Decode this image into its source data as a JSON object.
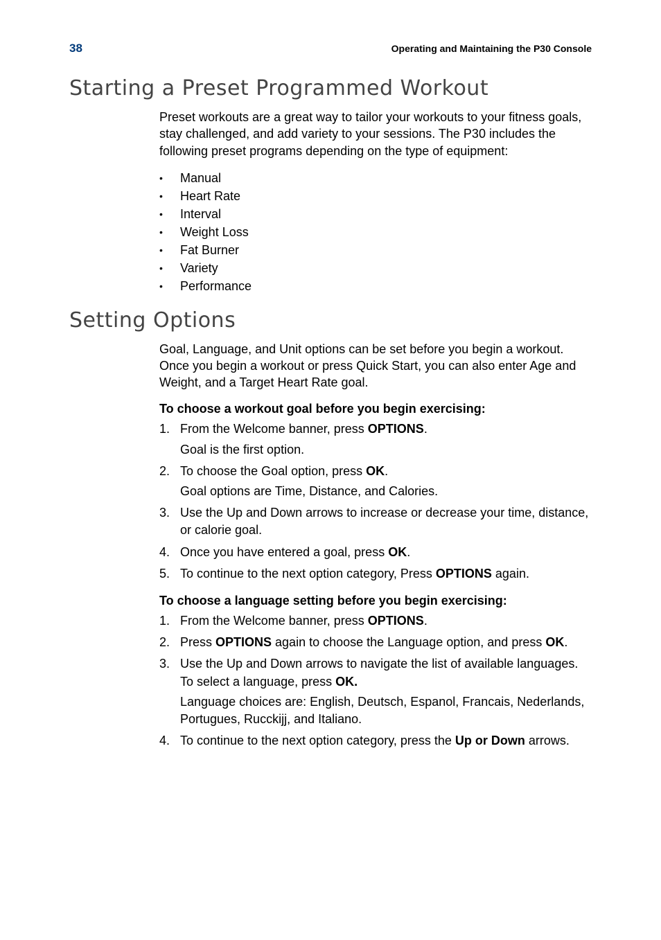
{
  "header": {
    "page_number": "38",
    "running_title": "Operating and Maintaining the P30 Console"
  },
  "section1": {
    "title": "Starting a Preset Programmed Workout",
    "intro": "Preset workouts are a great way to tailor your workouts to your fitness goals, stay challenged, and add variety to your sessions. The P30 includes the following preset programs depending on the type of equipment:",
    "bullets": [
      "Manual",
      "Heart Rate",
      "Interval",
      "Weight Loss",
      "Fat Burner",
      "Variety",
      "Performance"
    ]
  },
  "section2": {
    "title": "Setting Options",
    "intro": "Goal, Language, and Unit options can be set before you begin a workout. Once you begin a workout or press Quick Start, you can also enter Age and Weight, and a Target Heart Rate goal.",
    "procA": {
      "heading": "To choose a workout goal before you begin exercising:",
      "steps": [
        {
          "n": "1.",
          "pre": "From the Welcome banner, press ",
          "bold": "OPTIONS",
          "post": ".",
          "sub": "Goal is the first option."
        },
        {
          "n": "2.",
          "pre": "To choose the Goal option, press ",
          "bold": "OK",
          "post": ".",
          "sub": "Goal options are Time, Distance, and Calories."
        },
        {
          "n": "3.",
          "pre": "Use the Up and Down arrows to increase or decrease your time, distance, or calorie goal.",
          "bold": "",
          "post": "",
          "sub": ""
        },
        {
          "n": "4.",
          "pre": "Once you have entered a goal, press ",
          "bold": "OK",
          "post": ".",
          "sub": ""
        },
        {
          "n": "5.",
          "pre": "To continue to the next option category, Press ",
          "bold": "OPTIONS",
          "post": " again.",
          "sub": ""
        }
      ]
    },
    "procB": {
      "heading": "To choose a language setting before you begin exercising:",
      "steps": [
        {
          "n": "1.",
          "pre": "From the Welcome banner, press ",
          "bold": "OPTIONS",
          "post": ".",
          "sub": ""
        },
        {
          "n": "2.",
          "pre": "Press ",
          "bold": "OPTIONS",
          "post": " again to choose the Language option, and press ",
          "bold2": "OK",
          "post2": ".",
          "sub": ""
        },
        {
          "n": "3.",
          "pre": "Use the Up and Down arrows to navigate the list of available languages. To select a language, press ",
          "bold": "OK.",
          "post": "",
          "sub": "Language choices are: English, Deutsch, Espanol, Francais, Nederlands, Portugues, Rucckijj, and Italiano."
        },
        {
          "n": "4.",
          "pre": "To continue to the next option category, press the ",
          "bold": "Up or Down",
          "post": " arrows.",
          "sub": ""
        }
      ]
    }
  }
}
